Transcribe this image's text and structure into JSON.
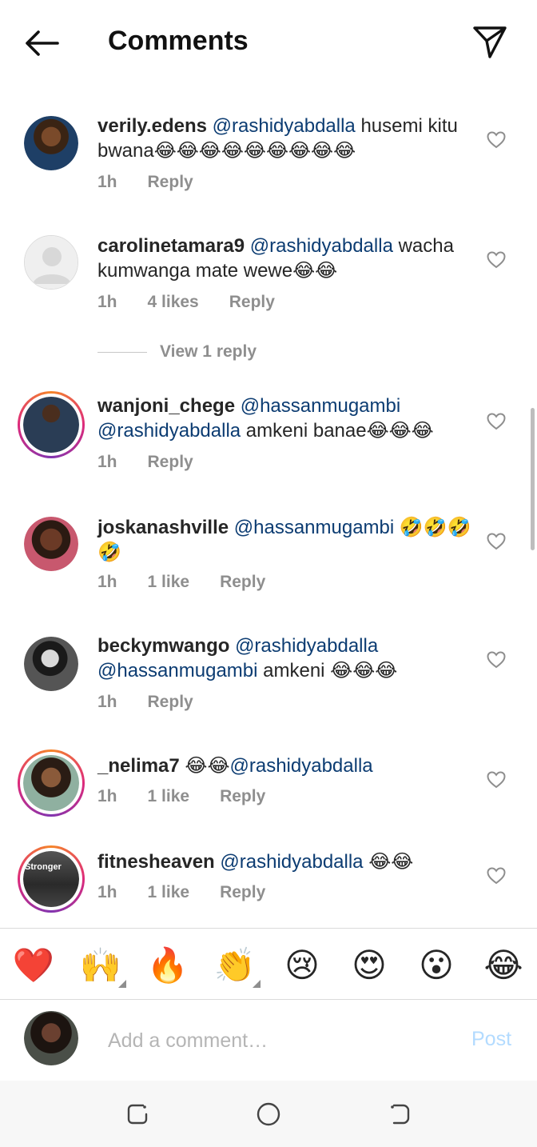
{
  "header": {
    "title": "Comments"
  },
  "comments": [
    {
      "username": "verily.edens",
      "mentions": "@rashidyabdalla",
      "body": " husemi kitu bwana😂😂😂😂😂😂😂😂😂",
      "time": "1h",
      "likes": "",
      "reply": "Reply"
    },
    {
      "username": "carolinetamara9",
      "mentions": "@rashidyabdalla",
      "body": " wacha kumwanga mate wewe😂😂",
      "time": "1h",
      "likes": "4 likes",
      "reply": "Reply"
    },
    {
      "username": "wanjoni_chege",
      "mentions": "@hassanmugambi @rashidyabdalla",
      "body": " amkeni banae😂😂😂",
      "time": "1h",
      "likes": "",
      "reply": "Reply"
    },
    {
      "username": "joskanashville",
      "mentions": "@hassanmugambi",
      "body": " 🤣🤣🤣🤣",
      "time": "1h",
      "likes": "1 like",
      "reply": "Reply"
    },
    {
      "username": "beckymwango",
      "mentions": "@rashidyabdalla @hassanmugambi",
      "body": "  amkeni 😂😂😂",
      "time": "1h",
      "likes": "",
      "reply": "Reply"
    },
    {
      "username": "_nelima7",
      "pre": " 😂😂",
      "mentions": "@rashidyabdalla",
      "body": "",
      "time": "1h",
      "likes": "1 like",
      "reply": "Reply"
    },
    {
      "username": "fitnesheaven",
      "mentions": "@rashidyabdalla",
      "body": " 😂😂",
      "time": "1h",
      "likes": "1 like",
      "reply": "Reply"
    }
  ],
  "view_reply": "View 1 reply",
  "avatar_badge": "Stronger",
  "emoji_bar": [
    "❤️",
    "🙌",
    "🔥",
    "👏",
    "😢",
    "😍",
    "😮",
    "😂"
  ],
  "composer": {
    "placeholder": "Add a comment…",
    "post_label": "Post"
  },
  "colors": {
    "mention": "#0c3c72",
    "meta": "#8e8e8e",
    "post": "#b3dbff"
  },
  "icons": {
    "back": "arrow-left-icon",
    "send": "paper-plane-icon",
    "like": "heart-outline-icon",
    "recents": "recents-icon",
    "home": "home-circle-icon",
    "back_nav": "back-nav-icon"
  }
}
